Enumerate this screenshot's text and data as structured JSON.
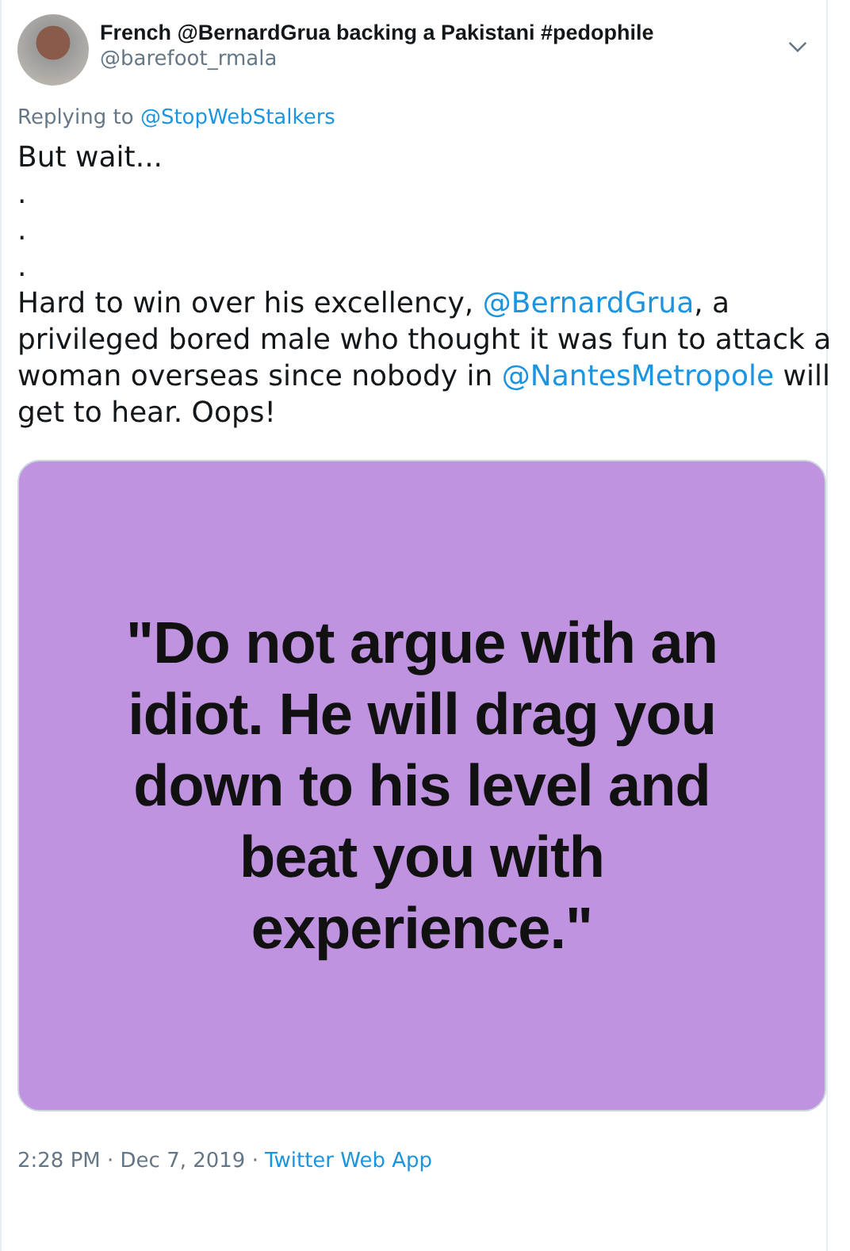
{
  "tweet": {
    "display_name": "French @BernardGrua backing a Pakistani #pedophile",
    "handle": "@barefoot_rmala",
    "replying_to": {
      "label": "Replying to",
      "mention": "@StopWebStalkers"
    },
    "lines": [
      "But wait...",
      ".",
      ".",
      "."
    ],
    "paragraph": [
      {
        "kind": "text",
        "text": "Hard to win over his excellency, "
      },
      {
        "kind": "mention",
        "text": "@BernardGrua"
      },
      {
        "kind": "text",
        "text": ", a privileged bored male who thought it was fun to attack a woman overseas since nobody in "
      },
      {
        "kind": "mention",
        "text": "@NantesMetropole"
      },
      {
        "kind": "text",
        "text": " will get to hear. Oops!"
      }
    ],
    "image_quote": "\"Do not argue with an idiot. He will drag you down to his level and beat you with experience.\"",
    "timestamp": "2:28 PM · Dec 7, 2019 ·",
    "source": "Twitter Web App"
  }
}
